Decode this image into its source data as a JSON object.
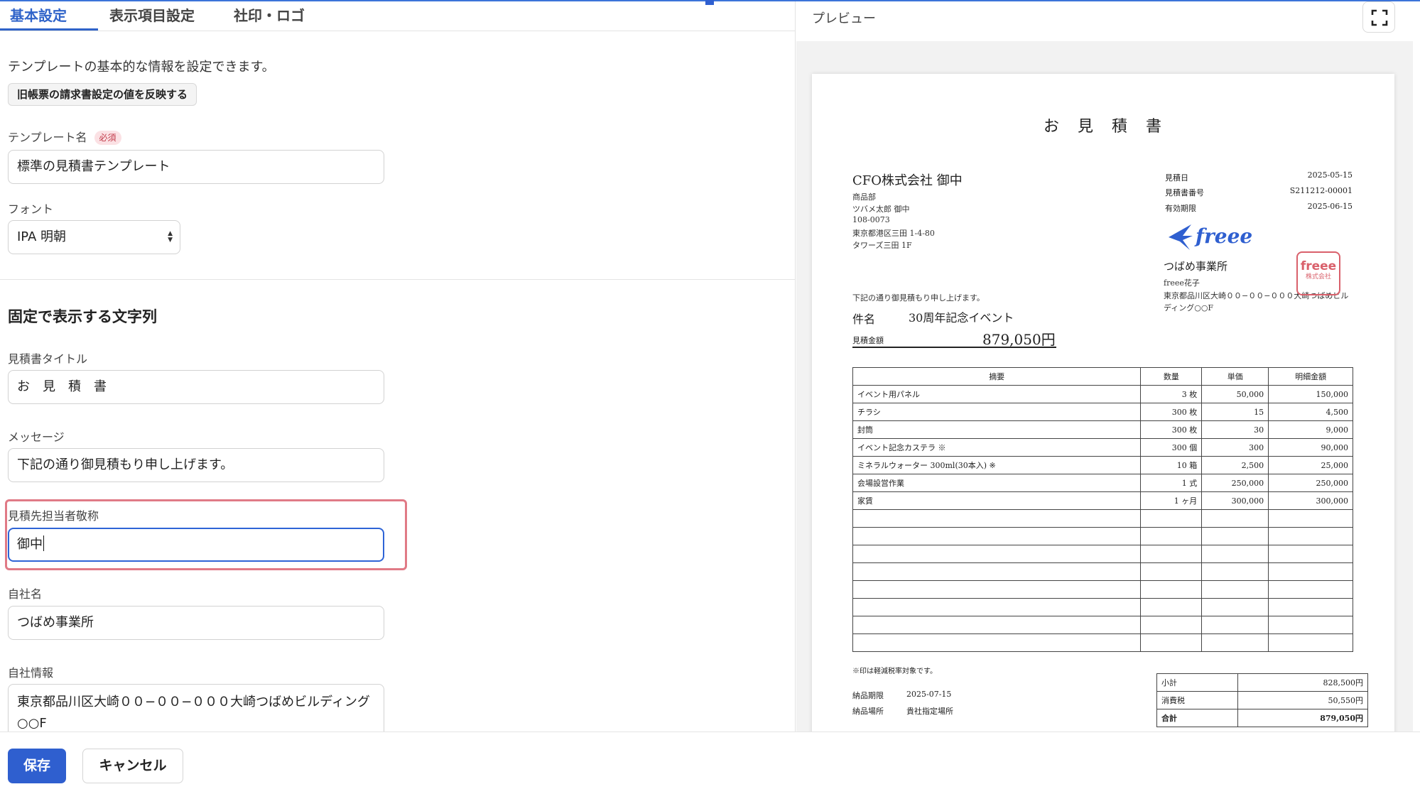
{
  "tabs": [
    "基本設定",
    "表示項目設定",
    "社印・ロゴ"
  ],
  "form": {
    "description": "テンプレートの基本的な情報を設定できます。",
    "reflect_button": "旧帳票の請求書設定の値を反映する",
    "template_name_label": "テンプレート名",
    "required_badge": "必須",
    "template_name_value": "標準の見積書テンプレート",
    "font_label": "フォント",
    "font_value": "IPA 明朝",
    "fixed_section_title": "固定で表示する文字列",
    "doc_title_label": "見積書タイトル",
    "doc_title_value": "お　見　積　書",
    "message_label": "メッセージ",
    "message_value": "下記の通り御見積もり申し上げます。",
    "honorific_label": "見積先担当者敬称",
    "honorific_value": "御中",
    "company_name_label": "自社名",
    "company_name_value": "つばめ事業所",
    "company_info_label": "自社情報",
    "company_info_value": "東京都品川区大崎００−００−０００大崎つばめビルディング○○F"
  },
  "footer": {
    "save": "保存",
    "cancel": "キャンセル"
  },
  "preview": {
    "title": "プレビュー",
    "fullscreen_icon": "expand-icon",
    "doc": {
      "title": "お　見　積　書",
      "client_name": "CFO株式会社 御中",
      "client_lines": [
        "商品部",
        "ツバメ太郎 御中",
        "108-0073",
        "東京都港区三田 1-4-80",
        "タワーズ三田 1F"
      ],
      "meta": [
        {
          "label": "見積日",
          "value": "2025-05-15"
        },
        {
          "label": "見積書番号",
          "value": "S211212-00001"
        },
        {
          "label": "有効期限",
          "value": "2025-06-15"
        }
      ],
      "logo_text": "freee",
      "company": "つばめ事業所",
      "staff": "freee花子",
      "company_address": "東京都品川区大崎００−００−０００大崎つばめビルディング○○F",
      "seal_main": "freee",
      "seal_sub": "株式会社",
      "message": "下記の通り御見積もり申し上げます。",
      "subject_label": "件名",
      "subject": "30周年記念イベント",
      "amount_label": "見積金額",
      "amount": "879,050円",
      "headers": [
        "摘要",
        "数量",
        "単価",
        "明細金額"
      ],
      "rows": [
        [
          "イベント用パネル",
          "3 枚",
          "50,000",
          "150,000"
        ],
        [
          "チラシ",
          "300 枚",
          "15",
          "4,500"
        ],
        [
          "封筒",
          "300 枚",
          "30",
          "9,000"
        ],
        [
          "イベント記念カステラ ※",
          "300 個",
          "300",
          "90,000"
        ],
        [
          "ミネラルウォーター 300ml(30本入) ※",
          "10 箱",
          "2,500",
          "25,000"
        ],
        [
          "会場設営作業",
          "1 式",
          "250,000",
          "250,000"
        ],
        [
          "家賃",
          "1 ヶ月",
          "300,000",
          "300,000"
        ]
      ],
      "note": "※印は軽減税率対象です。",
      "delivery": [
        {
          "label": "納品期限",
          "value": "2025-07-15"
        },
        {
          "label": "納品場所",
          "value": "貴社指定場所"
        }
      ],
      "totals": [
        {
          "label": "小計",
          "value": "828,500円"
        },
        {
          "label": "消費税",
          "value": "50,550円"
        },
        {
          "label": "合計",
          "value": "879,050円"
        }
      ]
    }
  }
}
